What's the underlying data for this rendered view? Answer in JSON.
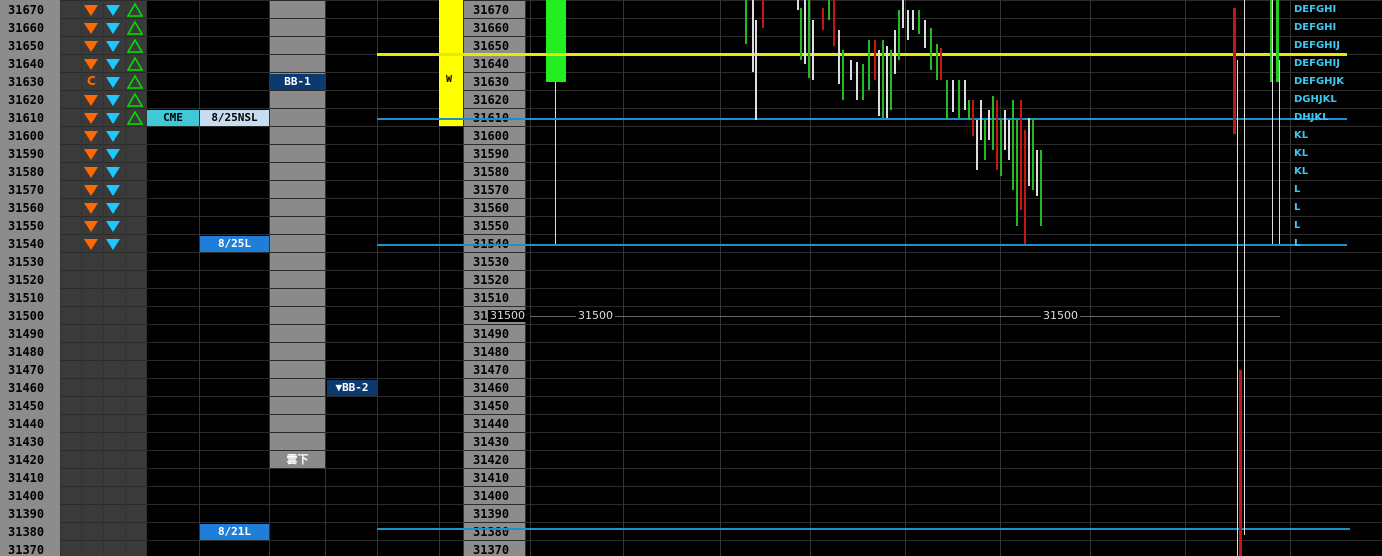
{
  "prices": [
    "31670",
    "31660",
    "31650",
    "31640",
    "31630",
    "31620",
    "31610",
    "31600",
    "31590",
    "31580",
    "31570",
    "31560",
    "31550",
    "31540",
    "31530",
    "31520",
    "31510",
    "31500",
    "31490",
    "31480",
    "31470",
    "31460",
    "31450",
    "31440",
    "31430",
    "31420",
    "31410",
    "31400",
    "31390",
    "31380",
    "31370"
  ],
  "tpo_letters": [
    "DEFGHI",
    "DEFGHI",
    "DEFGHIJ",
    "DEFGHIJ",
    "DEFGHJK",
    "DGHJKL",
    "DHJKL",
    "KL",
    "KL",
    "KL",
    "L",
    "L",
    "L",
    "L"
  ],
  "markers": {
    "c_label": "C",
    "cme": "CME",
    "nsl_825": "8/25NSL",
    "l_825": "8/25L",
    "l_821": "8/21L",
    "bb1": "BB-1",
    "bb2": "BB-2",
    "bb2_prefix": "▼",
    "cloud_down": "雲下",
    "w_mark": "W"
  },
  "chart_labels": {
    "level_price_left": "31500",
    "level_price_mid": "31500",
    "level_price_right": "31500"
  },
  "colors": {
    "price_bg": "#8c8c8c",
    "down_arrow": "#ff6a00",
    "blue_arrow": "#1ec8ff",
    "green_up": "#00e000",
    "cme_bg": "#3ec8d8",
    "date_bg": "#1e7ed8",
    "bb_bg": "#0c3a6e",
    "cloud_col": "#888888",
    "yellow": "#ffff00",
    "green_box": "#22ee22",
    "tpo_text": "#3cc8f0",
    "red_line": "#c81414"
  }
}
